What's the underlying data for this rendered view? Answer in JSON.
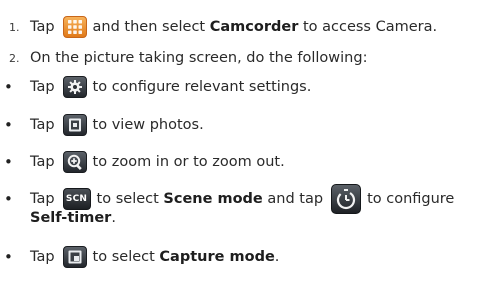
{
  "steps": [
    {
      "number": "1.",
      "before_icon": "Tap",
      "icon": "apps-grid-icon",
      "after_icon": "and then select",
      "bold": "Camcorder",
      "tail": "to access Camera."
    },
    {
      "number": "2.",
      "text": "On the picture taking screen, do the following:"
    }
  ],
  "bullets": [
    {
      "marker": "•",
      "before_icon": "Tap",
      "icon": "gear-settings-icon",
      "after_icon": "to configure relevant settings."
    },
    {
      "marker": "•",
      "before_icon": "Tap",
      "icon": "photo-viewer-icon",
      "after_icon": "to view photos."
    },
    {
      "marker": "•",
      "before_icon": "Tap",
      "icon": "zoom-in-icon",
      "after_icon": "to zoom in or to zoom out."
    },
    {
      "marker": "•",
      "before_icon": "Tap",
      "icon": "scene-mode-icon",
      "icon_text": "SCN",
      "mid": "to select",
      "bold": "Scene mode",
      "mid2": "and tap",
      "icon2": "self-timer-icon",
      "after_icon2": "to configure",
      "bold2": "Self-timer",
      "tail": "."
    },
    {
      "marker": "•",
      "before_icon": "Tap",
      "icon": "capture-mode-icon",
      "after_icon": "to select",
      "bold": "Capture mode",
      "tail": "."
    }
  ],
  "colors": {
    "text": "#2a2a2a",
    "apps_icon": "#e07a1a",
    "dark_icon": "#23272c"
  }
}
